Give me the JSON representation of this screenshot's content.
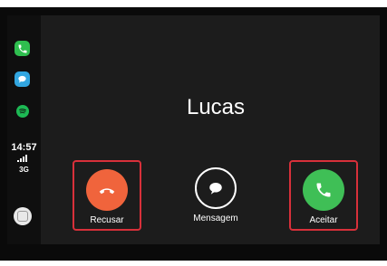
{
  "sidebar": {
    "apps": [
      {
        "name": "phone-icon"
      },
      {
        "name": "messages-icon"
      },
      {
        "name": "spotify-icon"
      }
    ],
    "time": "14:57",
    "network": "3G",
    "signal_level": 4
  },
  "call": {
    "caller": "Lucas",
    "decline_label": "Recusar",
    "message_label": "Mensagem",
    "accept_label": "Aceitar"
  },
  "colors": {
    "decline": "#f0643c",
    "accept": "#3fbf56",
    "highlight": "#d8303a"
  }
}
